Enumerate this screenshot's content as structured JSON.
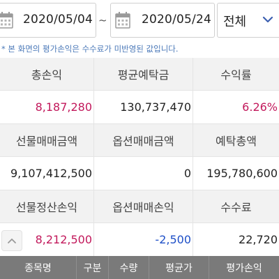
{
  "filter": {
    "start_date": "2020/05/04",
    "separator": "~",
    "end_date": "2020/05/24",
    "category": "전체"
  },
  "note": "* 본 화면의 평가손익은 수수료가 미반영된 값입니다.",
  "summary": {
    "row1": {
      "labels": [
        "총손익",
        "평균예탁금",
        "수익률"
      ],
      "values": [
        "8,187,280",
        "130,737,470",
        "6.26%"
      ]
    },
    "row2": {
      "labels": [
        "선물매매금액",
        "옵션매매금액",
        "예탁총액"
      ],
      "values": [
        "9,107,412,500",
        "0",
        "195,780,600"
      ]
    },
    "row3": {
      "labels": [
        "선물정산손익",
        "옵션매매손익",
        "수수료"
      ],
      "values": [
        "8,212,500",
        "-2,500",
        "22,720"
      ]
    }
  },
  "table": {
    "headers": [
      "종목명",
      "구분",
      "수량",
      "평균가",
      "평가손익"
    ]
  },
  "colors": {
    "positive": "#c2185b",
    "negative": "#1e4fc7",
    "note": "#4a78b8",
    "header_bg": "#7a7a7a"
  },
  "icons": [
    "calendar-icon",
    "chevron-down-icon",
    "chevron-up-icon"
  ]
}
